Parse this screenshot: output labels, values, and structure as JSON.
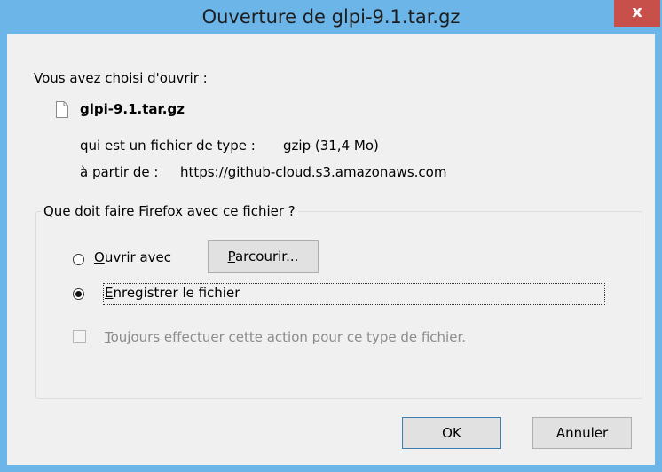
{
  "window": {
    "title": "Ouverture de glpi-9.1.tar.gz",
    "close_glyph": "x"
  },
  "header": {
    "intro": "Vous avez choisi d'ouvrir :"
  },
  "file": {
    "icon": "file-icon",
    "name": "glpi-9.1.tar.gz",
    "type_label": "qui est un fichier de type :",
    "type_value": "gzip (31,4 Mo)",
    "from_label": "à partir de :",
    "from_value": "https://github-cloud.s3.amazonaws.com"
  },
  "action_group": {
    "legend": "Que doit faire Firefox avec ce fichier ?",
    "open_with": {
      "accesskey": "O",
      "rest": "uvrir avec",
      "selected": false
    },
    "browse": {
      "accesskey": "P",
      "rest": "arcourir..."
    },
    "save_file": {
      "accesskey": "E",
      "rest": "nregistrer le fichier",
      "selected": true
    },
    "always": {
      "accesskey": "T",
      "rest": "oujours effectuer cette action pour ce type de fichier.",
      "checked": false,
      "disabled": true
    }
  },
  "footer": {
    "ok_label": "OK",
    "cancel_label": "Annuler"
  }
}
